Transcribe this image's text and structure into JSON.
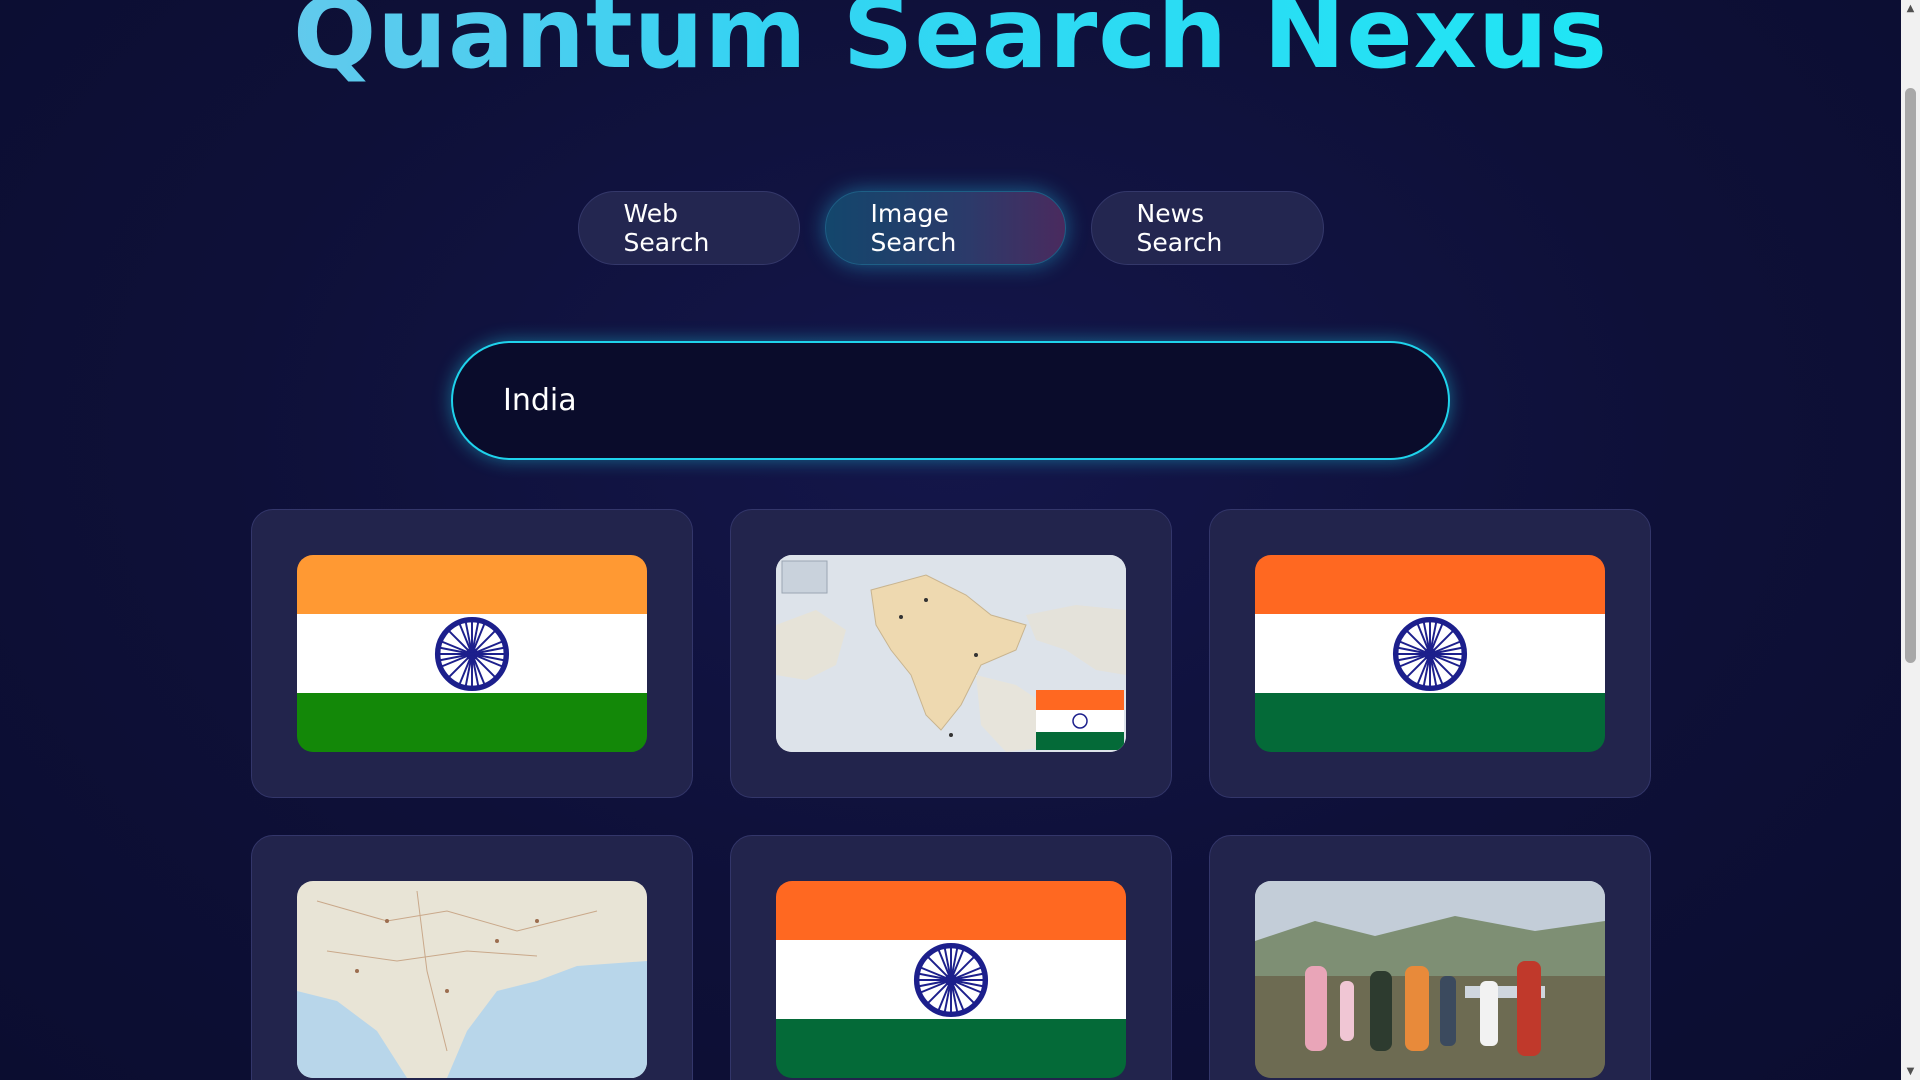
{
  "app": {
    "title": "Quantum Search Nexus"
  },
  "tabs": [
    {
      "label": "Web Search",
      "active": false
    },
    {
      "label": "Image Search",
      "active": true
    },
    {
      "label": "News Search",
      "active": false
    }
  ],
  "search": {
    "value": "India"
  },
  "results": [
    {
      "kind": "flag",
      "saffron": "#ff9933",
      "green": "#138808"
    },
    {
      "kind": "map-with-flag"
    },
    {
      "kind": "flag",
      "saffron": "#ff6821",
      "green": "#046a38"
    },
    {
      "kind": "map"
    },
    {
      "kind": "flag",
      "saffron": "#ff6821",
      "green": "#046a38"
    },
    {
      "kind": "photo"
    }
  ],
  "colors": {
    "accent": "#1fd3ec",
    "background": "#0d0f33",
    "card": "#22244c",
    "chakra": "#1c1f8c"
  }
}
